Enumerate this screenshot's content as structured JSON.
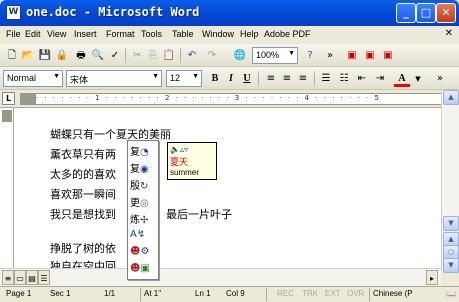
{
  "window": {
    "title": "one.doc - Microsoft Word"
  },
  "menu": {
    "items": [
      "File",
      "Edit",
      "View",
      "Insert",
      "Format",
      "Tools",
      "Table",
      "Window",
      "Help",
      "Adobe PDF"
    ]
  },
  "toolbar_standard": {
    "icons": [
      "new-icon",
      "open-icon",
      "save-icon",
      "permission-icon",
      "print-icon",
      "print-preview-icon",
      "spelling-icon",
      "cut-icon",
      "copy-icon",
      "paste-icon",
      "undo-icon",
      "redo-icon",
      "hyperlink-icon",
      "zoom-combo",
      "help-icon",
      "more-icon",
      "pdf-icon",
      "pdf-email-icon",
      "pdf-review-icon"
    ],
    "zoom": "100%"
  },
  "toolbar_format": {
    "style": "Normal",
    "font": "宋体",
    "size": "12",
    "bold": "B",
    "italic": "I",
    "underline": "U",
    "font_color_label": "A"
  },
  "ruler": {
    "numbers": "· · · · · · · 1 · · · · · · · 2 · · · · · · · 3 · · · · · · · 4 · · · · · · · 5"
  },
  "document": {
    "lines": [
      "蝴蝶只有一个夏天的美丽",
      "薰衣草只有两",
      "太多的的喜欢",
      "喜欢那一瞬间",
      "我只是想找到",
      "最后一片叶子",
      "挣脱了树的依",
      "独自在空中回"
    ]
  },
  "translation_popup": {
    "items": [
      "复",
      "复",
      "殷",
      "更",
      "炼",
      "A",
      "",
      ""
    ],
    "tooltip": {
      "chinese": "夏天",
      "english": "summer"
    }
  },
  "status_bar": {
    "page": "Page 1",
    "sec": "Sec 1",
    "pages": "1/1",
    "at": "At 1\"",
    "ln": "Ln 1",
    "col": "Col 9",
    "rec": "REC",
    "trk": "TRK",
    "ext": "EXT",
    "ovr": "OVR",
    "language": "Chinese (P"
  }
}
